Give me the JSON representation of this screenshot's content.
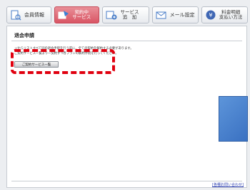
{
  "tabs": [
    {
      "label": "会員情報",
      "icon": "document-search-icon",
      "active": false
    },
    {
      "label_line1": "契約中",
      "label_line2": "サービス",
      "icon": "contract-services-icon",
      "active": true
    },
    {
      "label_line1": "サービス",
      "label_line2": "追　加",
      "icon": "add-service-icon",
      "active": false
    },
    {
      "label": "メール設定",
      "icon": "mail-icon",
      "active": false
    },
    {
      "label_line1": "料金明細",
      "label_line2": "支払い方法",
      "icon": "billing-icon",
      "active": false
    }
  ],
  "page": {
    "title": "退会申請",
    "desc_line1": "ッからリストすべて同の退会手続を行う前に、全ての契約を解約する必要があります。",
    "desc_line2": "ご契約サービス一覧より一契約ずつ各プランの解約手続を行ってください。",
    "service_button": "ご契約サービス一覧"
  },
  "footer": {
    "contact_link": "[各種お問い合わせ]"
  },
  "colors": {
    "highlight": "#e0000f",
    "active_tab": "#d95564",
    "blue_box": "#4a82cf"
  }
}
